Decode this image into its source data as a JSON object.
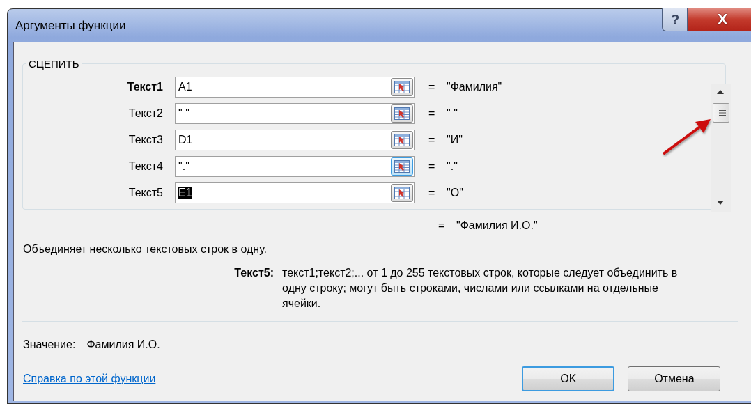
{
  "window": {
    "title": "Аргументы функции",
    "buttons": [
      {
        "kind": "help",
        "label": "?"
      },
      {
        "kind": "close",
        "label": "X"
      }
    ]
  },
  "function": {
    "name": "СЦЕПИТЬ",
    "arguments": [
      {
        "label": "Текст1",
        "required": true,
        "value": "A1",
        "result": "\"Фамилия\"",
        "focused": false,
        "hovered": false
      },
      {
        "label": "Текст2",
        "required": false,
        "value": "\" \"",
        "result": "\" \"",
        "focused": false,
        "hovered": false
      },
      {
        "label": "Текст3",
        "required": false,
        "value": "D1",
        "result": "\"И\"",
        "focused": false,
        "hovered": false
      },
      {
        "label": "Текст4",
        "required": false,
        "value": "\".\"",
        "result": "\".\"",
        "focused": false,
        "hovered": true
      },
      {
        "label": "Текст5",
        "required": false,
        "value": "E1",
        "result": "\"О\"",
        "focused": true,
        "hovered": false
      }
    ],
    "equals": "=",
    "total": "\"Фамилия И.О.\""
  },
  "description": "Объединяет несколько текстовых строк в одну.",
  "argument_help": {
    "label": "Текст5:",
    "text": "текст1;текст2;... от 1 до 255 текстовых строк, которые следует объединить в одну строку; могут быть строками, числами или ссылками на отдельные ячейки."
  },
  "result": {
    "label": "Значение:",
    "value": "Фамилия И.О."
  },
  "help_link": "Справка по этой функции",
  "buttons": [
    {
      "label": "OK",
      "default": true
    },
    {
      "label": "Отмена",
      "default": false
    }
  ],
  "annotation": {
    "kind": "arrow"
  }
}
